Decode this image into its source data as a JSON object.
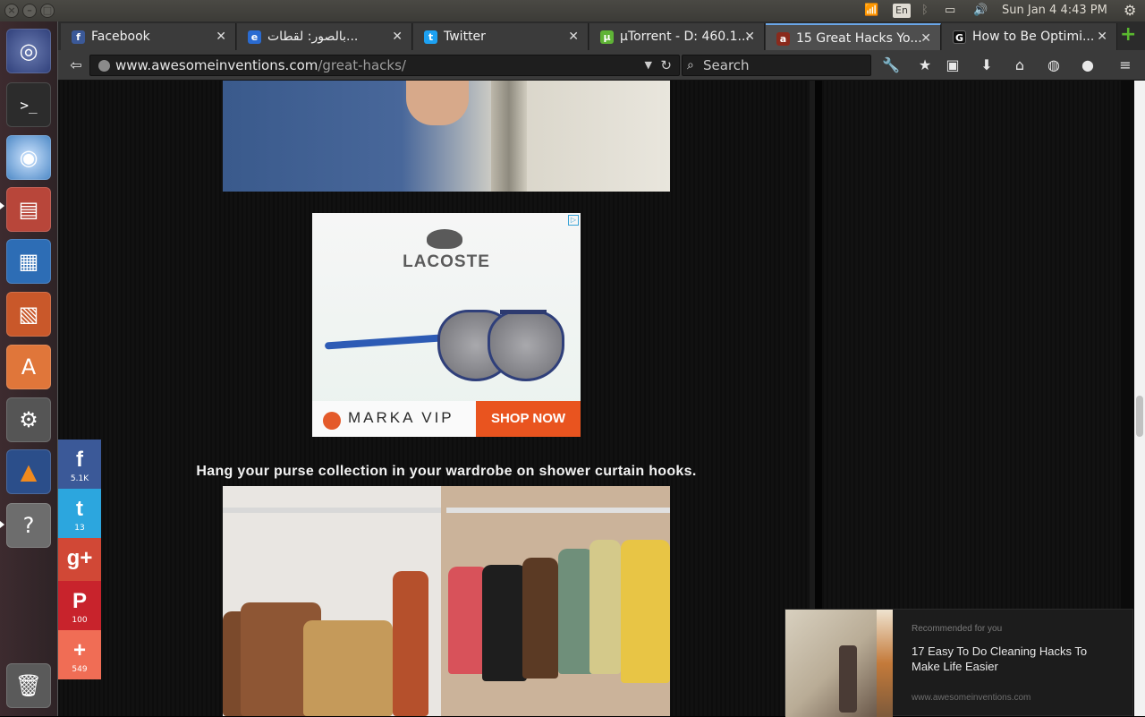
{
  "system_panel": {
    "language": "En",
    "datetime": "Sun Jan  4  4:43 PM",
    "window_controls": [
      "close-icon",
      "minimize-icon",
      "maximize-icon"
    ]
  },
  "launcher": {
    "items": [
      "ubuntu-dash-icon",
      "terminal-icon",
      "chromium-icon",
      "files-icon",
      "writer-icon",
      "impress-icon",
      "software-center-icon",
      "system-settings-icon",
      "vlc-icon",
      "help-icon",
      "trash-icon"
    ]
  },
  "tabs": [
    {
      "title": "Facebook",
      "favicon": "f",
      "color": "#3b5998"
    },
    {
      "title": "بالصور: لقطات...",
      "favicon": "e",
      "color": "#2a6bd1"
    },
    {
      "title": "Twitter",
      "favicon": "t",
      "color": "#1da1f2"
    },
    {
      "title": "µTorrent - D: 460.1...",
      "favicon": "µ",
      "color": "#5fb336"
    },
    {
      "title": "15 Great Hacks Yo...",
      "favicon": "a",
      "color": "#8a2a1c"
    },
    {
      "title": "How to Be Optimi...",
      "favicon": "G",
      "color": "#111111"
    }
  ],
  "active_tab": 4,
  "navbar": {
    "url_host": "www.awesomeinventions.com",
    "url_path": "/great-hacks/",
    "search_placeholder": "Search"
  },
  "ad": {
    "brand": "LACOSTE",
    "advertiser": "MARKA VIP",
    "cta": "SHOP NOW"
  },
  "article": {
    "caption": "Hang your purse collection in your wardrobe on shower curtain hooks."
  },
  "share": [
    {
      "network": "facebook",
      "glyph": "f",
      "count": "5.1K",
      "color": "#3b5998"
    },
    {
      "network": "twitter",
      "glyph": "t",
      "count": "13",
      "color": "#2ca6de"
    },
    {
      "network": "google-plus",
      "glyph": "g+",
      "count": "",
      "color": "#d14836"
    },
    {
      "network": "pinterest",
      "glyph": "P",
      "count": "100",
      "color": "#c8232c"
    },
    {
      "network": "more",
      "glyph": "+",
      "count": "549",
      "color": "#f06d55"
    }
  ],
  "recommendation": {
    "label": "Recommended for you",
    "title": "17 Easy To Do Cleaning Hacks To Make Life Easier",
    "url": "www.awesomeinventions.com"
  }
}
